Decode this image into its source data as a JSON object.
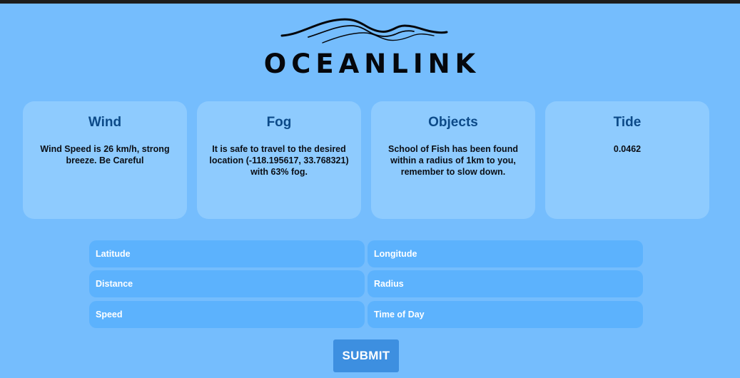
{
  "brand": {
    "name": "OCEANLINK",
    "logo_icon": "waves-icon"
  },
  "cards": [
    {
      "title": "Wind",
      "body": "Wind Speed is 26 km/h, strong breeze. Be Careful"
    },
    {
      "title": "Fog",
      "body": "It is safe to travel to the desired location (-118.195617, 33.768321) with 63% fog."
    },
    {
      "title": "Objects",
      "body": "School of Fish has been found within a radius of 1km to you, remember to slow down."
    },
    {
      "title": "Tide",
      "body": "0.0462"
    }
  ],
  "form": {
    "latitude_placeholder": "Latitude",
    "longitude_placeholder": "Longitude",
    "distance_placeholder": "Distance",
    "radius_placeholder": "Radius",
    "speed_placeholder": "Speed",
    "time_placeholder": "Time of Day",
    "submit_label": "SUBMIT"
  },
  "colors": {
    "background": "#75bdfd",
    "card": "#8ecbfe",
    "card_title": "#0c4a88",
    "field": "#5cb2fd",
    "button": "#3d8fe0"
  }
}
